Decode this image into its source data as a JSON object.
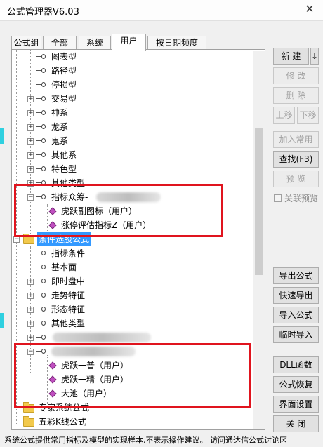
{
  "window": {
    "title": "公式管理器V6.03",
    "close_glyph": "✕"
  },
  "tabs": [
    "公式组",
    "全部",
    "系统",
    "用户",
    "按日期频度"
  ],
  "active_tab": "用户",
  "tree": {
    "items": [
      "图表型",
      "路径型",
      "停损型",
      "交易型",
      "神系",
      "龙系",
      "鬼系",
      "其他系",
      "特色型",
      "其他类型",
      "指标众筹-",
      "虎跃副图标（用户）",
      "涨停评估指标Z（用户）",
      "条件选股公式",
      "指标条件",
      "基本面",
      "即时盘中",
      "走势特征",
      "形态特征",
      "其他类型",
      "虎跃一普（用户）",
      "虎跃一精（用户）",
      "大池（用户）",
      "专家系统公式",
      "五彩K线公式"
    ]
  },
  "buttons": {
    "new": "新 建",
    "new_arrow": "↓",
    "modify": "修 改",
    "delete": "删 除",
    "move_up": "上移",
    "move_down": "下移",
    "add_common": "加入常用",
    "find": "查找(F3)",
    "preview": "预 览",
    "export": "导出公式",
    "quick_export": "快速导出",
    "import": "导入公式",
    "temp_import": "临时导入",
    "dll": "DLL函数",
    "restore": "公式恢复",
    "ui_settings": "界面设置",
    "close": "关 闭"
  },
  "checkbox": {
    "label": "关联预览",
    "checked": false
  },
  "status": {
    "text": "系统公式提供常用指标及模型的实现样本,不表示操作建议。  访问通达信公式讨论区"
  },
  "colors": {
    "highlight": "#e0141e",
    "selection": "#3399ff"
  }
}
